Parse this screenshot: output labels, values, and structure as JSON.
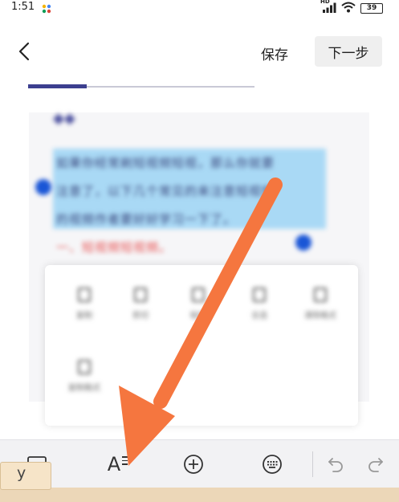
{
  "status_bar": {
    "time": "1:51",
    "network_label": "HD",
    "battery_level": "39",
    "icons": [
      "app-dots-icon",
      "signal-icon",
      "wifi-icon",
      "battery-icon"
    ]
  },
  "header": {
    "back_icon": "chevron-left-icon",
    "save_label": "保存",
    "next_label": "下一步"
  },
  "progress": {
    "value": 0.26
  },
  "editor": {
    "heading": "◆◆",
    "paragraph_lines": [
      "如果你经常刷短视频短视，那么你就要",
      "注意了，以下几个常见的来注意短视频",
      "的视频作者要好好学习一下了。"
    ],
    "red_heading": "一、短视频短视频。"
  },
  "context_menu": {
    "items": [
      {
        "label": "复制",
        "icon": "copy-icon"
      },
      {
        "label": "剪切",
        "icon": "cut-icon"
      },
      {
        "label": "粘贴",
        "icon": "paste-icon"
      },
      {
        "label": "全选",
        "icon": "select-all-icon"
      },
      {
        "label": "清除格式",
        "icon": "link-icon"
      },
      {
        "label": "复制格式",
        "icon": "format-brush-icon"
      }
    ]
  },
  "toolbar": {
    "tools": [
      "image-icon",
      "text-format-icon",
      "add-circle-icon",
      "keyboard-icon",
      "undo-icon",
      "redo-icon"
    ],
    "format_glyph": "A"
  },
  "keyboard": {
    "ime_candidate": "y"
  },
  "colors": {
    "progress_fill": "#3c3f8f",
    "arrow": "#f5763f",
    "selection": "#a9d9f5",
    "handle": "#1a56d6",
    "red_heading": "#e74c4c"
  }
}
